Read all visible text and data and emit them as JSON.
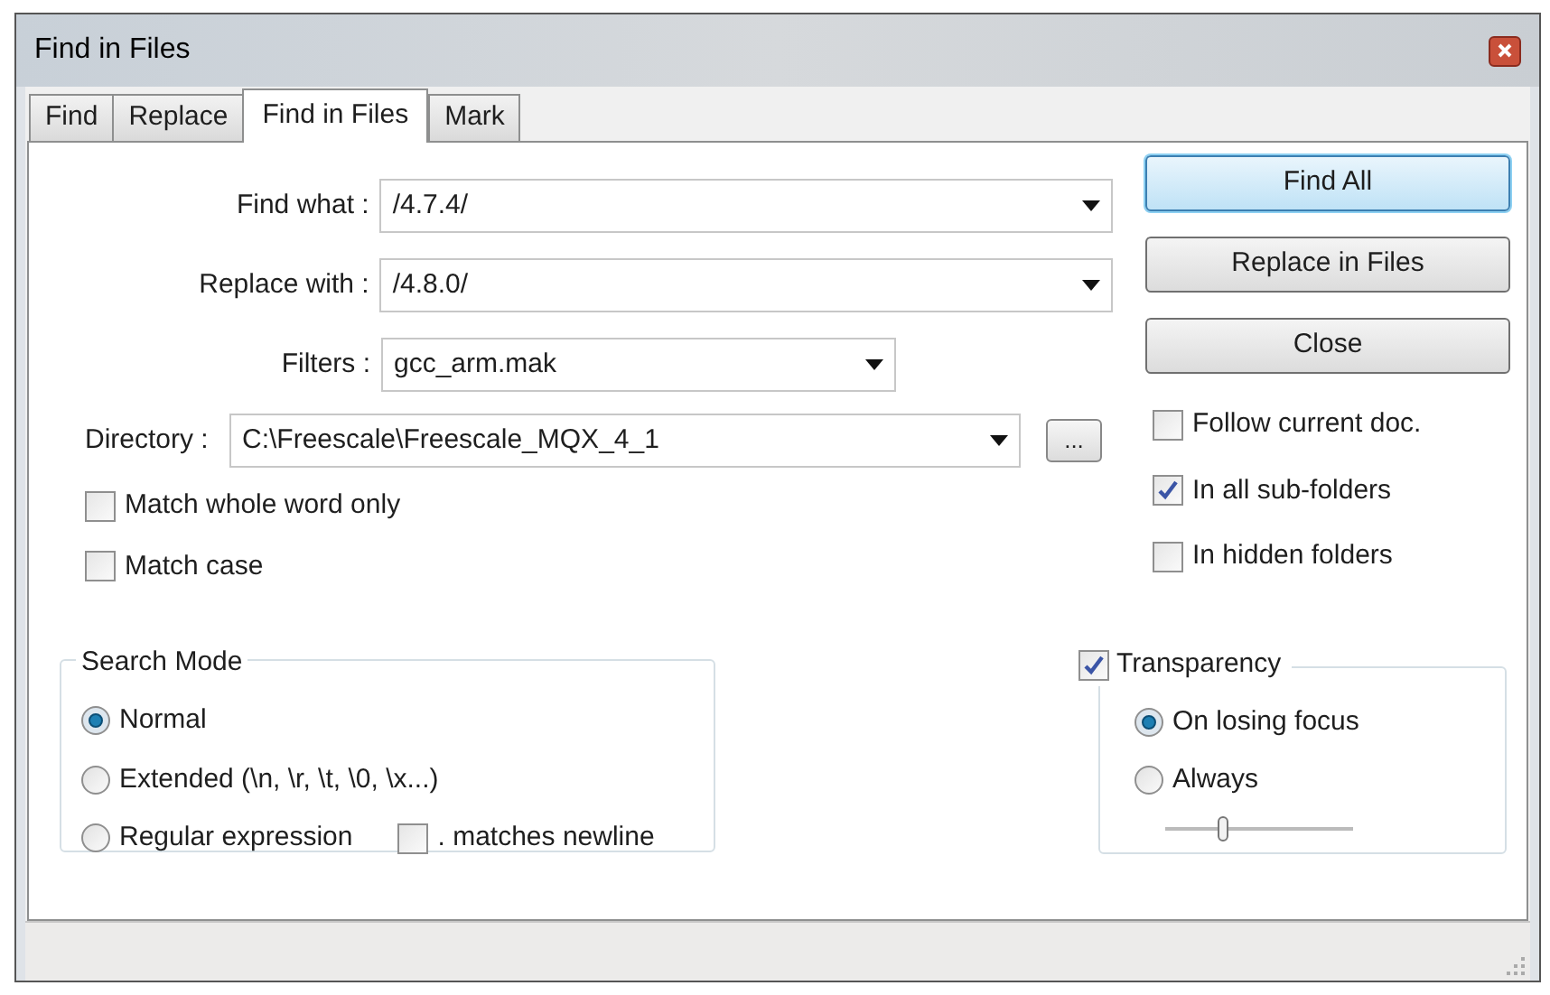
{
  "window": {
    "title": "Find in Files"
  },
  "tabs": [
    {
      "label": "Find",
      "selected": false
    },
    {
      "label": "Replace",
      "selected": false
    },
    {
      "label": "Find in Files",
      "selected": true
    },
    {
      "label": "Mark",
      "selected": false
    }
  ],
  "fields": [
    {
      "label": "Find what :",
      "value": "/4.7.4/",
      "kind": "wide"
    },
    {
      "label": "Replace with :",
      "value": "/4.8.0/",
      "kind": "wide"
    },
    {
      "label": "Filters :",
      "value": "gcc_arm.mak",
      "kind": "narrow"
    }
  ],
  "directory": {
    "label": "Directory :",
    "value": "C:\\Freescale\\Freescale_MQX_4_1",
    "browse_button": "..."
  },
  "buttons": [
    {
      "label": "Find All",
      "default": true
    },
    {
      "label": "Replace in Files",
      "default": false
    },
    {
      "label": "Close",
      "default": false
    }
  ],
  "left_options": [
    {
      "label": "Match whole word only",
      "checked": false
    },
    {
      "label": "Match case",
      "checked": false
    }
  ],
  "right_options": [
    {
      "label": "Follow current doc.",
      "checked": false
    },
    {
      "label": "In all sub-folders",
      "checked": true
    },
    {
      "label": "In hidden folders",
      "checked": false
    }
  ],
  "search_mode": {
    "title": "Search Mode",
    "options": [
      {
        "label": "Normal",
        "selected": true
      },
      {
        "label": "Extended (\\n, \\r, \\t, \\0, \\x...)",
        "selected": false
      },
      {
        "label": "Regular expression",
        "selected": false
      }
    ],
    "dot_matches_newline": {
      "label": ". matches newline",
      "checked": false
    }
  },
  "transparency": {
    "label": "Transparency",
    "checked": true,
    "options": [
      {
        "label": "On losing focus",
        "selected": true
      },
      {
        "label": "Always",
        "selected": false
      }
    ],
    "slider": {
      "level": 0.3
    }
  }
}
